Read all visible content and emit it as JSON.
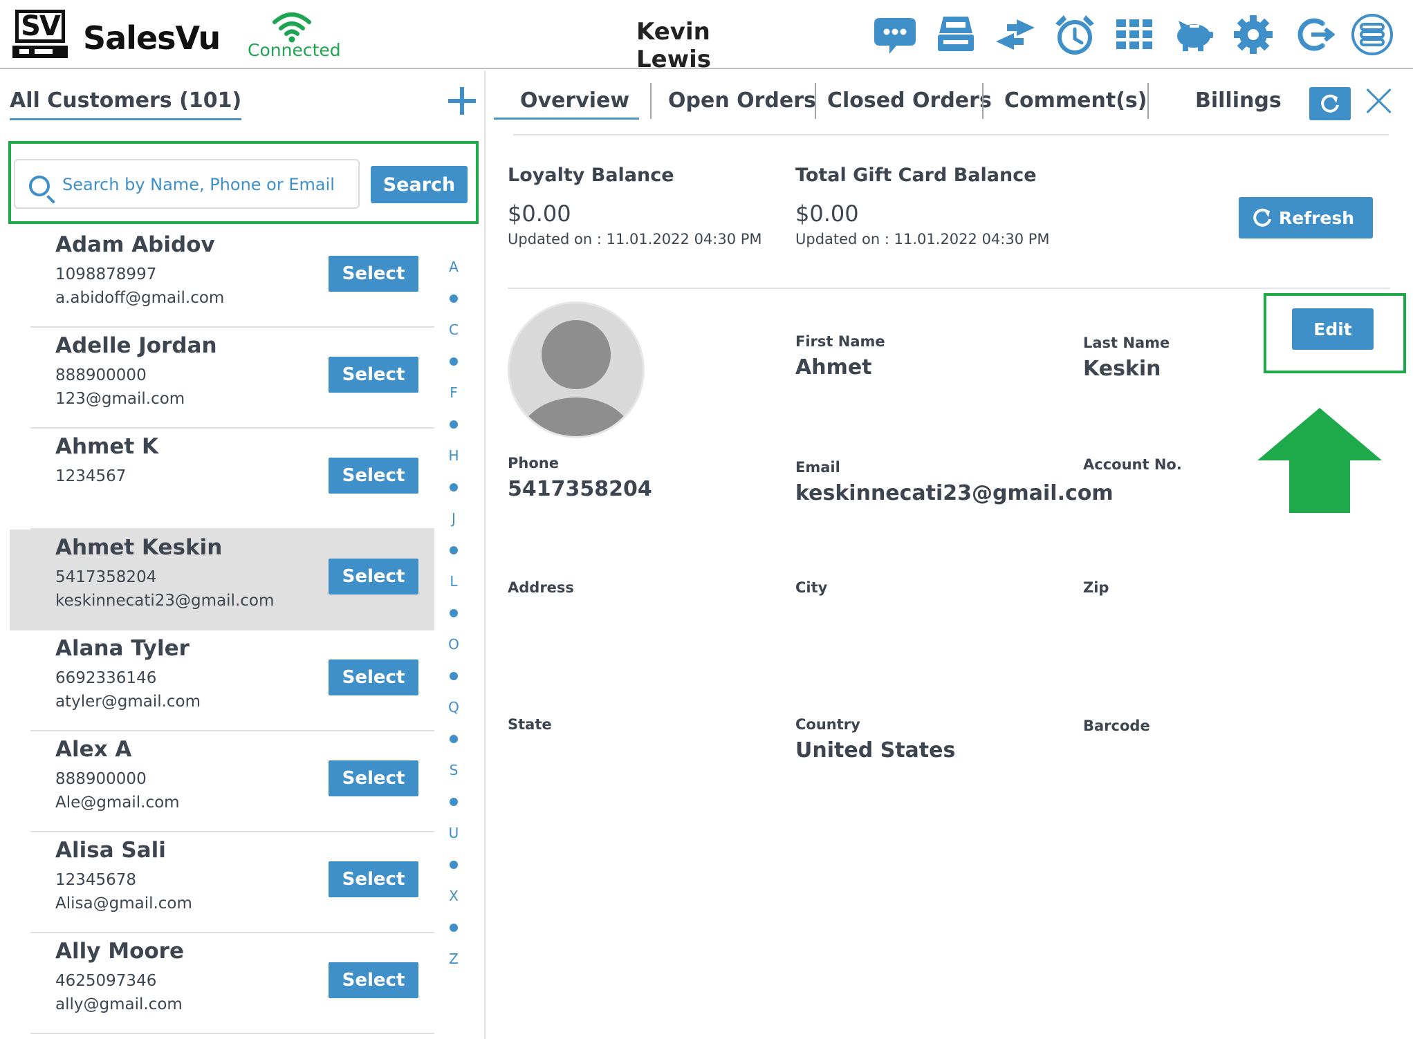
{
  "header": {
    "brand": "SalesVu",
    "logo_text": "SV",
    "connection_status": "Connected",
    "user_name": "Kevin Lewis",
    "icons": [
      "chat-icon",
      "register-icon",
      "transfer-icon",
      "alarm-icon",
      "grid-icon",
      "piggy-bank-icon",
      "gear-icon",
      "logout-icon",
      "menu-icon"
    ]
  },
  "customers": {
    "title": "All Customers (101)",
    "search": {
      "placeholder": "Search by Name, Phone or Email",
      "button": "Search"
    },
    "items": [
      {
        "name": "Adam Abidov",
        "phone": "1098878997",
        "email": "a.abidoff@gmail.com",
        "select": "Select"
      },
      {
        "name": "Adelle Jordan",
        "phone": "888900000",
        "email": "123@gmail.com",
        "select": "Select"
      },
      {
        "name": "Ahmet K",
        "phone": "1234567",
        "email": "",
        "select": "Select"
      },
      {
        "name": "Ahmet Keskin",
        "phone": "5417358204",
        "email": "keskinnecati23@gmail.com",
        "select": "Select",
        "selected": true
      },
      {
        "name": "Alana Tyler",
        "phone": "6692336146",
        "email": "atyler@gmail.com",
        "select": "Select"
      },
      {
        "name": "Alex A",
        "phone": "888900000",
        "email": "Ale@gmail.com",
        "select": "Select"
      },
      {
        "name": "Alisa Sali",
        "phone": "12345678",
        "email": "Alisa@gmail.com",
        "select": "Select"
      },
      {
        "name": "Ally Moore",
        "phone": "4625097346",
        "email": "ally@gmail.com",
        "select": "Select"
      }
    ],
    "alphabet": [
      "A",
      "C",
      "F",
      "H",
      "J",
      "L",
      "O",
      "Q",
      "S",
      "U",
      "X",
      "Z"
    ]
  },
  "detail": {
    "tabs": [
      "Overview",
      "Open Orders",
      "Closed Orders",
      "Comment(s)",
      "Billings"
    ],
    "active_tab": "Overview",
    "loyalty": {
      "label": "Loyalty Balance",
      "value": "$0.00",
      "updated_label": "Updated on :",
      "updated": "11.01.2022 04:30 PM"
    },
    "gift_card": {
      "label": "Total Gift Card Balance",
      "value": "$0.00",
      "updated_label": "Updated on :",
      "updated": "11.01.2022 04:30 PM"
    },
    "refresh_button": "Refresh",
    "edit_button": "Edit",
    "fields": {
      "first_name": {
        "label": "First Name",
        "value": "Ahmet"
      },
      "last_name": {
        "label": "Last Name",
        "value": "Keskin"
      },
      "phone": {
        "label": "Phone",
        "value": "5417358204"
      },
      "email": {
        "label": "Email",
        "value": "keskinnecati23@gmail.com"
      },
      "account_no": {
        "label": "Account No.",
        "value": ""
      },
      "address": {
        "label": "Address",
        "value": ""
      },
      "city": {
        "label": "City",
        "value": ""
      },
      "zip": {
        "label": "Zip",
        "value": ""
      },
      "state": {
        "label": "State",
        "value": ""
      },
      "country": {
        "label": "Country",
        "value": "United States"
      },
      "barcode": {
        "label": "Barcode",
        "value": ""
      }
    }
  },
  "colors": {
    "accent": "#3f8fc9",
    "highlight_green": "#1eaa4a",
    "connected_green": "#1ea553",
    "selected_row": "#e0e0e0",
    "text": "#3d4650"
  }
}
